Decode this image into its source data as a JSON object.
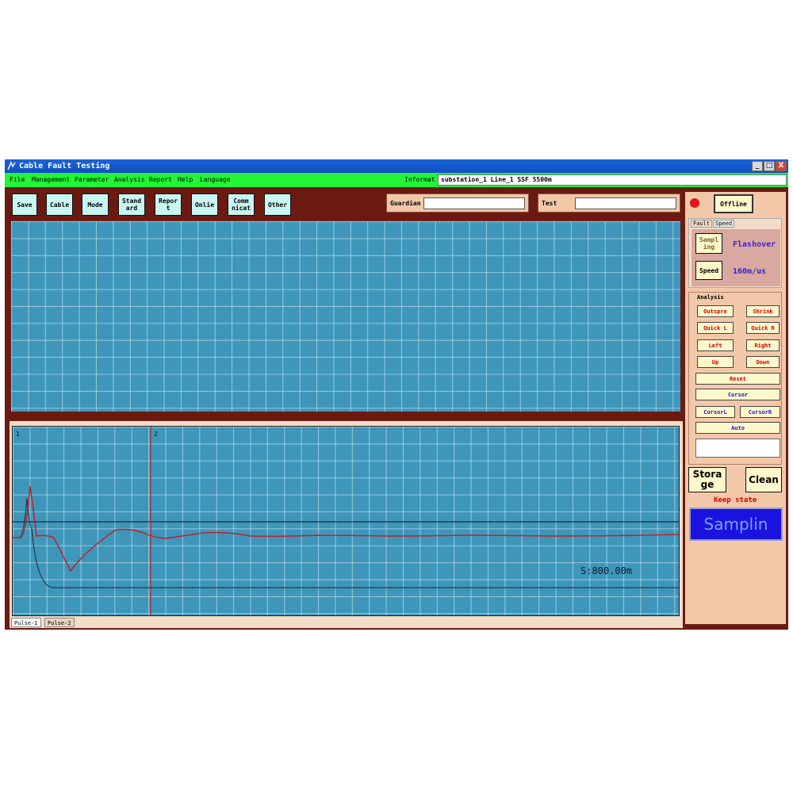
{
  "window": {
    "title": "Cable Fault Testing",
    "controls": [
      "_",
      "□",
      "X"
    ]
  },
  "menu": {
    "items": [
      "File",
      "Management",
      "Parameter",
      "Analysis",
      "Report",
      "Help",
      "Language"
    ],
    "info_label": "Informat",
    "info_value": "substation_1   Line_1   SSF   5500m"
  },
  "toolbar": {
    "buttons": [
      "Save",
      "Cable",
      "Mode",
      "Stand\nard",
      "Repor\nt",
      "Onlie",
      "Comm\nnicat",
      "Other"
    ],
    "guardian_label": "Guardian",
    "guardian_value": "",
    "test_label": "Test",
    "test_value": ""
  },
  "waveform": {
    "cursor1_label": "1",
    "cursor2_label": "2",
    "readout": "S:800.00m",
    "tabs": [
      "Pulse-1",
      "Pulse-2"
    ]
  },
  "right_panel": {
    "offline_label": "Offline",
    "status_color": "#e8121a",
    "tabs": [
      "Fault",
      "Speed"
    ],
    "sampling_button": "Sampl\ning",
    "sampling_value": "Flashover",
    "speed_button": "Speed",
    "speed_value": "160m/us",
    "analysis_title": "Analysis",
    "analysis_buttons": {
      "outspread": "Outspre",
      "shrink": "Shrink",
      "quick_l": "Quick L",
      "quick_r": "Quick R",
      "left": "Left",
      "right": "Right",
      "up": "Up",
      "down": "Down",
      "reset": "Reset",
      "cursor_all": "Cursor",
      "cursor_l": "CursorL",
      "cursor_r": "CursorR",
      "auto": "Auto"
    },
    "storage_label": "Stora\nge",
    "clean_label": "Clean",
    "keep_state": "Keep state",
    "sampling_label": "Samplin"
  },
  "colors": {
    "frame": "#6b1a12",
    "plot_bg": "#3e97ba",
    "menu_bg": "#21f535",
    "panel_bg": "#f3c8a8",
    "trace_red": "#c0202a",
    "trace_dark": "#2a3a48",
    "sampling_bg": "#1a13e0"
  }
}
